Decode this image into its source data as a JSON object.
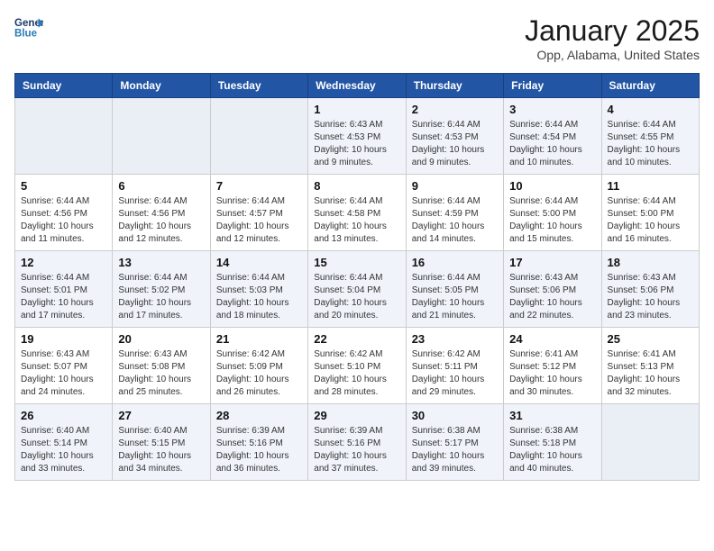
{
  "header": {
    "logo_line1": "General",
    "logo_line2": "Blue",
    "month": "January 2025",
    "location": "Opp, Alabama, United States"
  },
  "weekdays": [
    "Sunday",
    "Monday",
    "Tuesday",
    "Wednesday",
    "Thursday",
    "Friday",
    "Saturday"
  ],
  "weeks": [
    [
      {
        "day": "",
        "sunrise": "",
        "sunset": "",
        "daylight": ""
      },
      {
        "day": "",
        "sunrise": "",
        "sunset": "",
        "daylight": ""
      },
      {
        "day": "",
        "sunrise": "",
        "sunset": "",
        "daylight": ""
      },
      {
        "day": "1",
        "sunrise": "Sunrise: 6:43 AM",
        "sunset": "Sunset: 4:53 PM",
        "daylight": "Daylight: 10 hours and 9 minutes."
      },
      {
        "day": "2",
        "sunrise": "Sunrise: 6:44 AM",
        "sunset": "Sunset: 4:53 PM",
        "daylight": "Daylight: 10 hours and 9 minutes."
      },
      {
        "day": "3",
        "sunrise": "Sunrise: 6:44 AM",
        "sunset": "Sunset: 4:54 PM",
        "daylight": "Daylight: 10 hours and 10 minutes."
      },
      {
        "day": "4",
        "sunrise": "Sunrise: 6:44 AM",
        "sunset": "Sunset: 4:55 PM",
        "daylight": "Daylight: 10 hours and 10 minutes."
      }
    ],
    [
      {
        "day": "5",
        "sunrise": "Sunrise: 6:44 AM",
        "sunset": "Sunset: 4:56 PM",
        "daylight": "Daylight: 10 hours and 11 minutes."
      },
      {
        "day": "6",
        "sunrise": "Sunrise: 6:44 AM",
        "sunset": "Sunset: 4:56 PM",
        "daylight": "Daylight: 10 hours and 12 minutes."
      },
      {
        "day": "7",
        "sunrise": "Sunrise: 6:44 AM",
        "sunset": "Sunset: 4:57 PM",
        "daylight": "Daylight: 10 hours and 12 minutes."
      },
      {
        "day": "8",
        "sunrise": "Sunrise: 6:44 AM",
        "sunset": "Sunset: 4:58 PM",
        "daylight": "Daylight: 10 hours and 13 minutes."
      },
      {
        "day": "9",
        "sunrise": "Sunrise: 6:44 AM",
        "sunset": "Sunset: 4:59 PM",
        "daylight": "Daylight: 10 hours and 14 minutes."
      },
      {
        "day": "10",
        "sunrise": "Sunrise: 6:44 AM",
        "sunset": "Sunset: 5:00 PM",
        "daylight": "Daylight: 10 hours and 15 minutes."
      },
      {
        "day": "11",
        "sunrise": "Sunrise: 6:44 AM",
        "sunset": "Sunset: 5:00 PM",
        "daylight": "Daylight: 10 hours and 16 minutes."
      }
    ],
    [
      {
        "day": "12",
        "sunrise": "Sunrise: 6:44 AM",
        "sunset": "Sunset: 5:01 PM",
        "daylight": "Daylight: 10 hours and 17 minutes."
      },
      {
        "day": "13",
        "sunrise": "Sunrise: 6:44 AM",
        "sunset": "Sunset: 5:02 PM",
        "daylight": "Daylight: 10 hours and 17 minutes."
      },
      {
        "day": "14",
        "sunrise": "Sunrise: 6:44 AM",
        "sunset": "Sunset: 5:03 PM",
        "daylight": "Daylight: 10 hours and 18 minutes."
      },
      {
        "day": "15",
        "sunrise": "Sunrise: 6:44 AM",
        "sunset": "Sunset: 5:04 PM",
        "daylight": "Daylight: 10 hours and 20 minutes."
      },
      {
        "day": "16",
        "sunrise": "Sunrise: 6:44 AM",
        "sunset": "Sunset: 5:05 PM",
        "daylight": "Daylight: 10 hours and 21 minutes."
      },
      {
        "day": "17",
        "sunrise": "Sunrise: 6:43 AM",
        "sunset": "Sunset: 5:06 PM",
        "daylight": "Daylight: 10 hours and 22 minutes."
      },
      {
        "day": "18",
        "sunrise": "Sunrise: 6:43 AM",
        "sunset": "Sunset: 5:06 PM",
        "daylight": "Daylight: 10 hours and 23 minutes."
      }
    ],
    [
      {
        "day": "19",
        "sunrise": "Sunrise: 6:43 AM",
        "sunset": "Sunset: 5:07 PM",
        "daylight": "Daylight: 10 hours and 24 minutes."
      },
      {
        "day": "20",
        "sunrise": "Sunrise: 6:43 AM",
        "sunset": "Sunset: 5:08 PM",
        "daylight": "Daylight: 10 hours and 25 minutes."
      },
      {
        "day": "21",
        "sunrise": "Sunrise: 6:42 AM",
        "sunset": "Sunset: 5:09 PM",
        "daylight": "Daylight: 10 hours and 26 minutes."
      },
      {
        "day": "22",
        "sunrise": "Sunrise: 6:42 AM",
        "sunset": "Sunset: 5:10 PM",
        "daylight": "Daylight: 10 hours and 28 minutes."
      },
      {
        "day": "23",
        "sunrise": "Sunrise: 6:42 AM",
        "sunset": "Sunset: 5:11 PM",
        "daylight": "Daylight: 10 hours and 29 minutes."
      },
      {
        "day": "24",
        "sunrise": "Sunrise: 6:41 AM",
        "sunset": "Sunset: 5:12 PM",
        "daylight": "Daylight: 10 hours and 30 minutes."
      },
      {
        "day": "25",
        "sunrise": "Sunrise: 6:41 AM",
        "sunset": "Sunset: 5:13 PM",
        "daylight": "Daylight: 10 hours and 32 minutes."
      }
    ],
    [
      {
        "day": "26",
        "sunrise": "Sunrise: 6:40 AM",
        "sunset": "Sunset: 5:14 PM",
        "daylight": "Daylight: 10 hours and 33 minutes."
      },
      {
        "day": "27",
        "sunrise": "Sunrise: 6:40 AM",
        "sunset": "Sunset: 5:15 PM",
        "daylight": "Daylight: 10 hours and 34 minutes."
      },
      {
        "day": "28",
        "sunrise": "Sunrise: 6:39 AM",
        "sunset": "Sunset: 5:16 PM",
        "daylight": "Daylight: 10 hours and 36 minutes."
      },
      {
        "day": "29",
        "sunrise": "Sunrise: 6:39 AM",
        "sunset": "Sunset: 5:16 PM",
        "daylight": "Daylight: 10 hours and 37 minutes."
      },
      {
        "day": "30",
        "sunrise": "Sunrise: 6:38 AM",
        "sunset": "Sunset: 5:17 PM",
        "daylight": "Daylight: 10 hours and 39 minutes."
      },
      {
        "day": "31",
        "sunrise": "Sunrise: 6:38 AM",
        "sunset": "Sunset: 5:18 PM",
        "daylight": "Daylight: 10 hours and 40 minutes."
      },
      {
        "day": "",
        "sunrise": "",
        "sunset": "",
        "daylight": ""
      }
    ]
  ]
}
